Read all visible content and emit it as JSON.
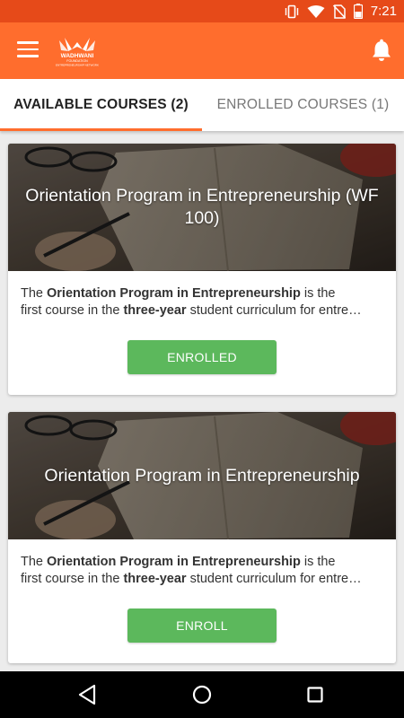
{
  "status_bar": {
    "time": "7:21",
    "icons": [
      "vibrate-icon",
      "wifi-icon",
      "no-sim-icon",
      "battery-icon"
    ],
    "color": "#e64a19"
  },
  "app_bar": {
    "color": "#ff6d2d",
    "logo_text": "WADHWANI",
    "logo_subtext": "FOUNDATION",
    "logo_tagline": "ENTREPRENEURSHIP NETWORK"
  },
  "tabs": [
    {
      "label": "AVAILABLE COURSES (2)",
      "active": true
    },
    {
      "label": "ENROLLED COURSES (1)",
      "active": false
    }
  ],
  "courses": [
    {
      "title": "Orientation Program in Entrepreneurship (WF 100)",
      "desc_line1_pre": "The ",
      "desc_line1_bold": "Orientation Program in Entrepreneurship",
      "desc_line1_post": " is the",
      "desc_line2_pre": "first course in the ",
      "desc_line2_bold": "three-year",
      "desc_line2_post": " student curriculum for entre…",
      "button_label": "ENROLLED"
    },
    {
      "title": "Orientation Program in Entrepreneurship",
      "desc_line1_pre": "The ",
      "desc_line1_bold": "Orientation Program in Entrepreneurship",
      "desc_line1_post": " is the",
      "desc_line2_pre": "first course in the ",
      "desc_line2_bold": "three-year",
      "desc_line2_post": " student curriculum for entre…",
      "button_label": "ENROLL"
    }
  ],
  "colors": {
    "accent": "#ff6d2d",
    "button": "#5cb85c"
  }
}
